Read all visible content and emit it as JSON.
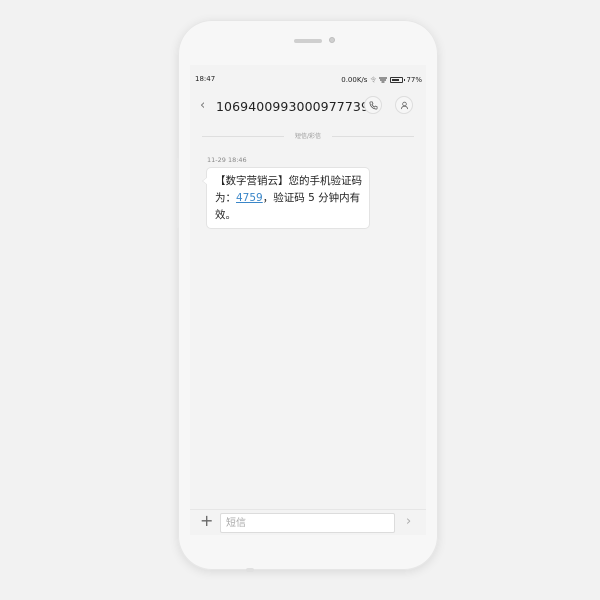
{
  "status_bar": {
    "time": "18:47",
    "speed": "0.00K/s",
    "signal": "令",
    "battery_percent": "77%",
    "battery_level": 0.77
  },
  "conversation": {
    "back_icon": "chevron-left-icon",
    "contact_number": "1069400993000977739",
    "call_icon": "phone-icon",
    "contact_icon": "person-icon"
  },
  "message_type_label": "短信/彩信",
  "message": {
    "timestamp": "11-29 18:46",
    "text_before": "【数字营销云】您的手机验证码为：",
    "code": "4759",
    "text_after": "，验证码 5 分钟内有效。"
  },
  "composer": {
    "add_icon": "plus-icon",
    "placeholder": "短信",
    "value": "",
    "send_icon": "chevron-right-icon"
  },
  "colors": {
    "link": "#3a86c8",
    "background": "#f3f3f3",
    "bubble": "#ffffff"
  }
}
